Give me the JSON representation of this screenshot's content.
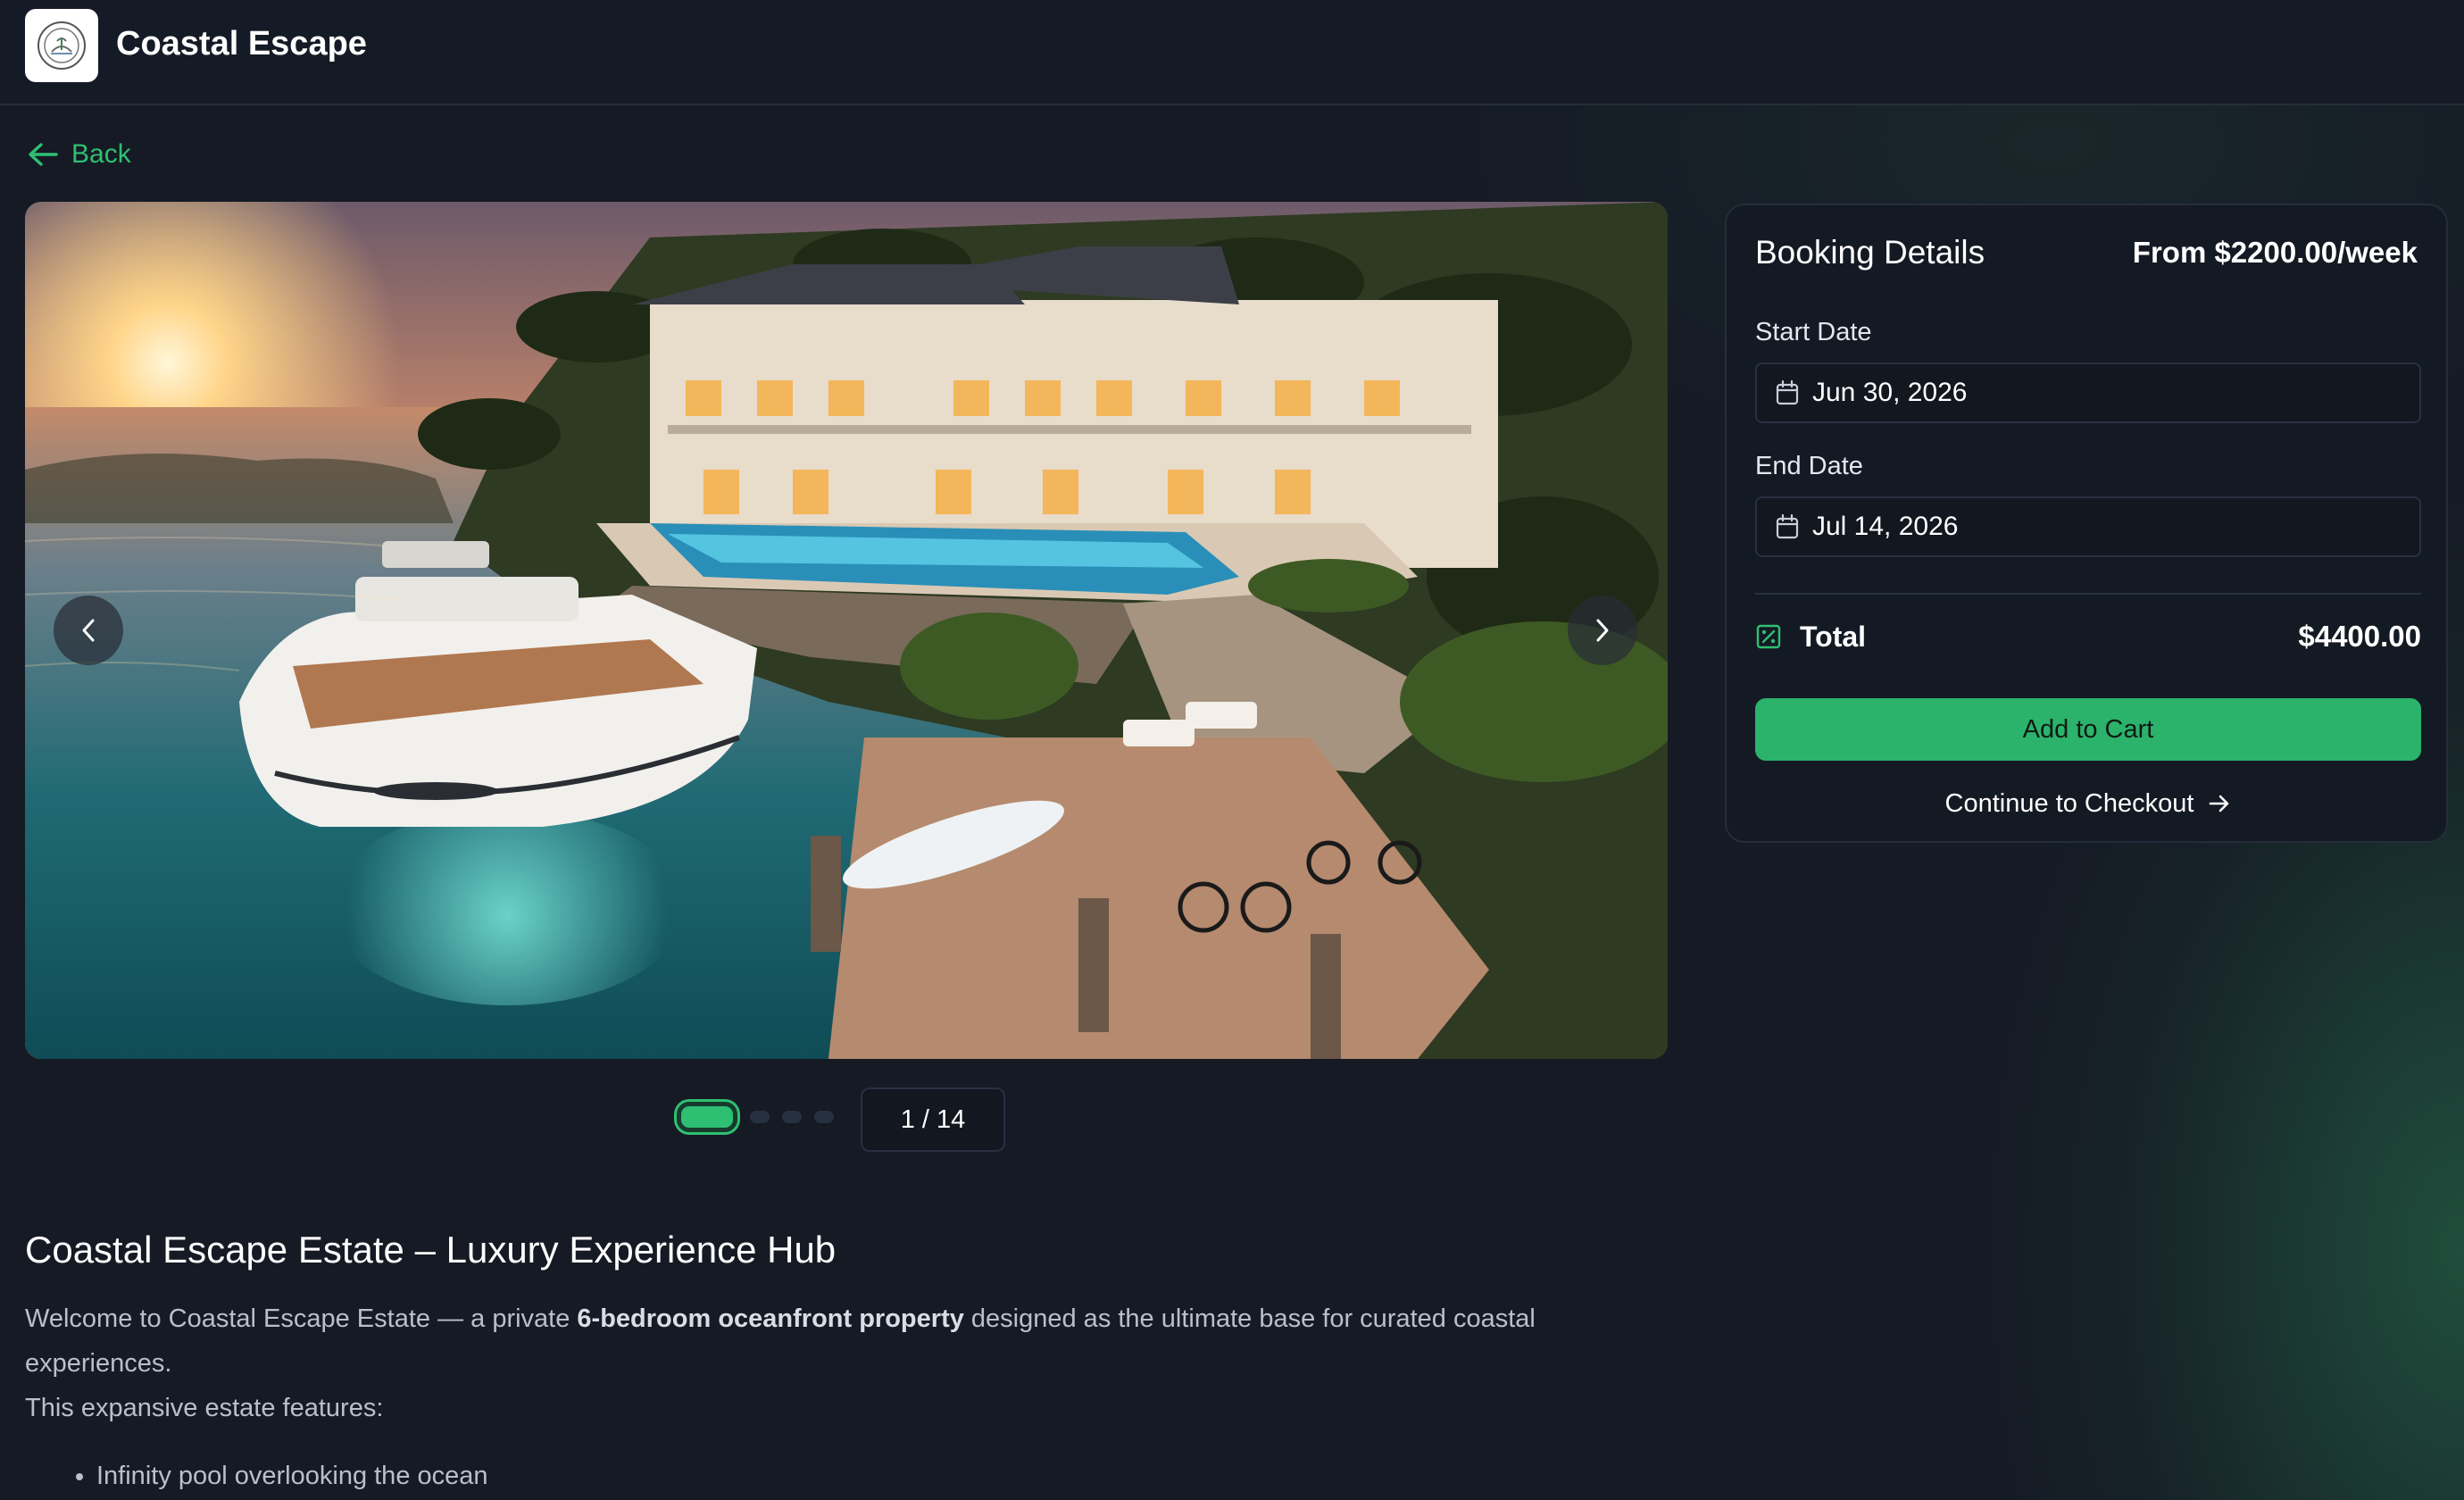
{
  "header": {
    "brand": "Coastal Escape",
    "logo_icon": "estate-seal-logo"
  },
  "nav": {
    "back_label": "Back"
  },
  "gallery": {
    "counter": "1 / 14",
    "current_index": 1,
    "total": 14,
    "dot_count": 4,
    "active_dot": 1
  },
  "listing": {
    "title": "Coastal Escape Estate – Luxury Experience Hub",
    "desc_pre": "Welcome to Coastal Escape Estate — a private ",
    "desc_bold": "6-bedroom oceanfront property",
    "desc_post": " designed as the ultimate base for curated coastal experiences.",
    "features_intro": "This expansive estate features:",
    "features": [
      "Infinity pool overlooking the ocean"
    ]
  },
  "booking": {
    "title": "Booking Details",
    "price": "From $2200.00/week",
    "start_label": "Start Date",
    "start_value": "Jun 30, 2026",
    "end_label": "End Date",
    "end_value": "Jul 14, 2026",
    "total_label": "Total",
    "total_value": "$4400.00",
    "add_to_cart": "Add to Cart",
    "checkout": "Continue to Checkout"
  },
  "colors": {
    "accent": "#2fbf73",
    "background": "#151a24",
    "panel": "#141a24",
    "button": "#2bb36b"
  }
}
